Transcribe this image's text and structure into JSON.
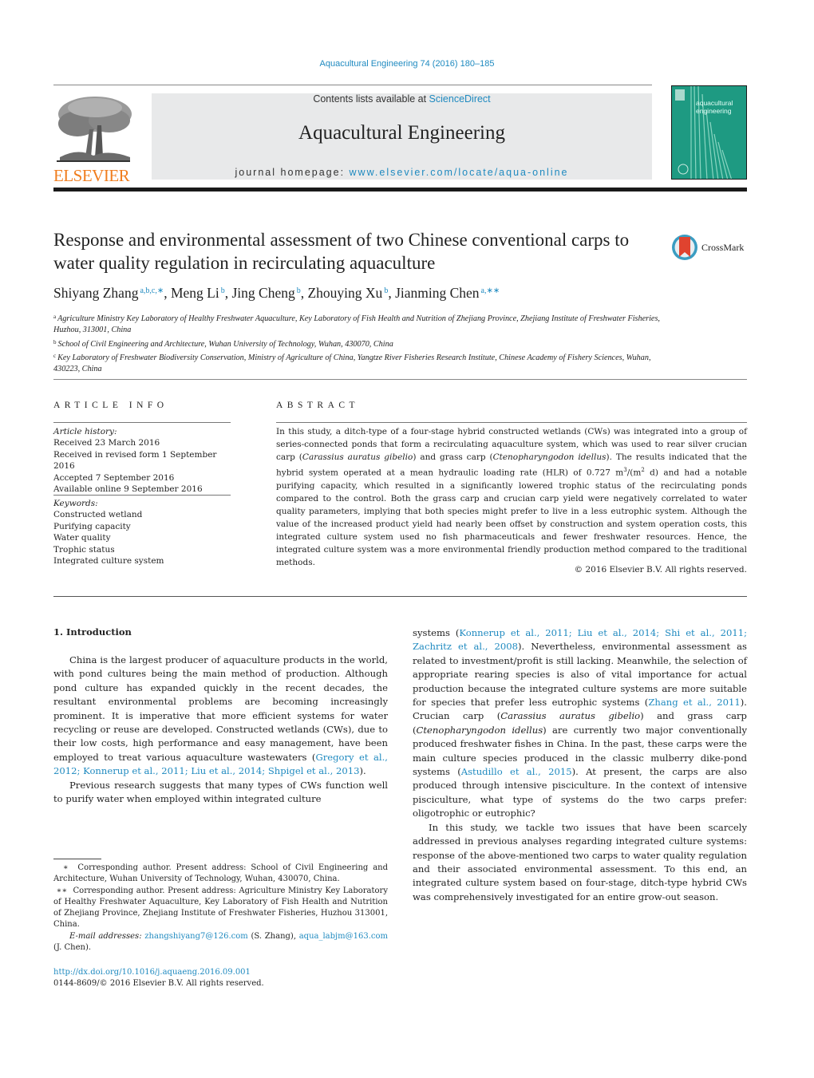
{
  "header": {
    "journal_reference": "Aquacultural Engineering 74 (2016) 180–185",
    "contents_prefix": "Contents lists available at ",
    "contents_link": "ScienceDirect",
    "journal_title": "Aquacultural Engineering",
    "homepage_prefix": "journal homepage: ",
    "homepage_link": "www.elsevier.com/locate/aqua-online",
    "publisher_logo_text": "ELSEVIER",
    "cover_text_line1": "aquacultural",
    "cover_text_line2": "engineering",
    "crossmark_label": "CrossMark"
  },
  "colors": {
    "link": "#1f8ac0",
    "elsevier_orange": "#f07d1e",
    "cover_green": "#1e9a82",
    "masthead_gray": "#e8e9ea",
    "crossmark_red": "#e0432f",
    "crossmark_ring": "#3a9dc2"
  },
  "article": {
    "title": "Response and environmental assessment of two Chinese conventional carps to water quality regulation in recirculating aquaculture",
    "authors": [
      {
        "name": "Shiyang Zhang",
        "sup": "a,b,c,∗",
        "sep": ", "
      },
      {
        "name": "Meng Li",
        "sup": "b",
        "sep": ", "
      },
      {
        "name": "Jing Cheng",
        "sup": "b",
        "sep": ", "
      },
      {
        "name": "Zhouying Xu",
        "sup": "b",
        "sep": ", "
      },
      {
        "name": "Jianming Chen",
        "sup": "a,∗∗",
        "sep": ""
      }
    ],
    "affiliations": [
      {
        "key": "a",
        "text": "Agriculture Ministry Key Laboratory of Healthy Freshwater Aquaculture, Key Laboratory of Fish Health and Nutrition of Zhejiang Province, Zhejiang Institute of Freshwater Fisheries, Huzhou, 313001, China"
      },
      {
        "key": "b",
        "text": "School of Civil Engineering and Architecture, Wuhan University of Technology, Wuhan, 430070, China"
      },
      {
        "key": "c",
        "text": "Key Laboratory of Freshwater Biodiversity Conservation, Ministry of Agriculture of China, Yangtze River Fisheries Research Institute, Chinese Academy of Fishery Sciences, Wuhan, 430223, China"
      }
    ]
  },
  "article_info": {
    "label": "ARTICLE INFO",
    "history_heading": "Article history:",
    "history": [
      "Received 23 March 2016",
      "Received in revised form 1 September 2016",
      "Accepted 7 September 2016",
      "Available online 9 September 2016"
    ],
    "keywords_heading": "Keywords:",
    "keywords": [
      "Constructed wetland",
      "Purifying capacity",
      "Water quality",
      "Trophic status",
      "Integrated culture system"
    ]
  },
  "abstract": {
    "label": "ABSTRACT",
    "segments": [
      {
        "t": "In this study, a ditch-type of a four-stage hybrid constructed wetlands (CWs) was integrated into a group of series-connected ponds that form a recirculating aquaculture system, which was used to rear silver crucian carp (",
        "s": "n"
      },
      {
        "t": "Carassius auratus gibelio",
        "s": "i"
      },
      {
        "t": ") and grass carp (",
        "s": "n"
      },
      {
        "t": "Ctenopharyngodon idellus",
        "s": "i"
      },
      {
        "t": "). The results indicated that the hybrid system operated at a mean hydraulic loading rate (HLR) of 0.727 m",
        "s": "n"
      },
      {
        "t": "3",
        "s": "sup"
      },
      {
        "t": "/(m",
        "s": "n"
      },
      {
        "t": "2",
        "s": "sup"
      },
      {
        "t": " d) and had a notable purifying capacity, which resulted in a significantly lowered trophic status of the recirculating ponds compared to the control. Both the grass carp and crucian carp yield were negatively correlated to water quality parameters, implying that both species might prefer to live in a less eutrophic system. Although the value of the increased product yield had nearly been offset by construction and system operation costs, this integrated culture system used no fish pharmaceuticals and fewer freshwater resources. Hence, the integrated culture system was a more environmental friendly production method compared to the traditional methods.",
        "s": "n"
      }
    ],
    "copyright": "© 2016 Elsevier B.V. All rights reserved."
  },
  "introduction": {
    "heading": "1.  Introduction",
    "left_paragraphs": [
      [
        {
          "t": "China is the largest producer of aquaculture products in the world, with pond cultures being the main method of production. Although pond culture has expanded quickly in the recent decades, the resultant environmental problems are becoming increasingly prominent. It is imperative that more efficient systems for water recycling or reuse are developed. Constructed wetlands (CWs), due to their low costs, high performance and easy management, have been employed to treat various aquaculture wastewaters (",
          "s": "n"
        },
        {
          "t": "Gregory et al., 2012; Konnerup et al., 2011; Liu et al., 2014; Shpigel et al., 2013",
          "s": "l"
        },
        {
          "t": ").",
          "s": "n"
        }
      ],
      [
        {
          "t": "Previous research suggests that many types of CWs function well to purify water when employed within integrated culture",
          "s": "n"
        }
      ]
    ],
    "right_paragraphs": [
      [
        {
          "t": "systems (",
          "s": "n"
        },
        {
          "t": "Konnerup et al., 2011; Liu et al., 2014; Shi et al., 2011; Zachritz et al., 2008",
          "s": "l"
        },
        {
          "t": "). Nevertheless, environmental assessment as related to investment/profit is still lacking. Meanwhile, the selection of appropriate rearing species is also of vital importance for actual production because the integrated culture systems are more suitable for species that prefer less eutrophic systems (",
          "s": "n"
        },
        {
          "t": "Zhang et al., 2011",
          "s": "l"
        },
        {
          "t": "). Crucian carp (",
          "s": "n"
        },
        {
          "t": "Carassius auratus gibelio",
          "s": "i"
        },
        {
          "t": ") and grass carp (",
          "s": "n"
        },
        {
          "t": "Ctenopharyngodon idellus",
          "s": "i"
        },
        {
          "t": ") are currently two major conventionally produced freshwater fishes in China. In the past, these carps were the main culture species produced in the classic mulberry dike-pond systems (",
          "s": "n"
        },
        {
          "t": "Astudillo et al., 2015",
          "s": "l"
        },
        {
          "t": "). At present, the carps are also produced through intensive pisciculture. In the context of intensive pisciculture, what type of systems do the two carps prefer: oligotrophic or eutrophic?",
          "s": "n"
        }
      ],
      [
        {
          "t": "In this study, we tackle two issues that have been scarcely addressed in previous analyses regarding integrated culture systems: response of the above-mentioned two carps to water quality regulation and their associated environmental assessment. To this end, an integrated culture system based on four-stage, ditch-type hybrid CWs was comprehensively investigated for an entire grow-out season.",
          "s": "n"
        }
      ]
    ]
  },
  "footnotes": {
    "note1_mark": "∗",
    "note1": "Corresponding author. Present address: School of Civil Engineering and Architecture, Wuhan University of Technology, Wuhan, 430070, China.",
    "note2_mark": "∗∗",
    "note2": "Corresponding author. Present address: Agriculture Ministry Key Laboratory of Healthy Freshwater Aquaculture, Key Laboratory of Fish Health and Nutrition of Zhejiang Province, Zhejiang Institute of Freshwater Fisheries, Huzhou 313001, China.",
    "email_heading": "E-mail addresses:",
    "email1": "zhangshiyang7@126.com",
    "email1_owner": " (S. Zhang), ",
    "email2": "aqua_labjm@163.com",
    "email2_owner": " (J. Chen)."
  },
  "footer": {
    "doi": "http://dx.doi.org/10.1016/j.aquaeng.2016.09.001",
    "issn_copyright": "0144-8609/© 2016 Elsevier B.V. All rights reserved."
  }
}
